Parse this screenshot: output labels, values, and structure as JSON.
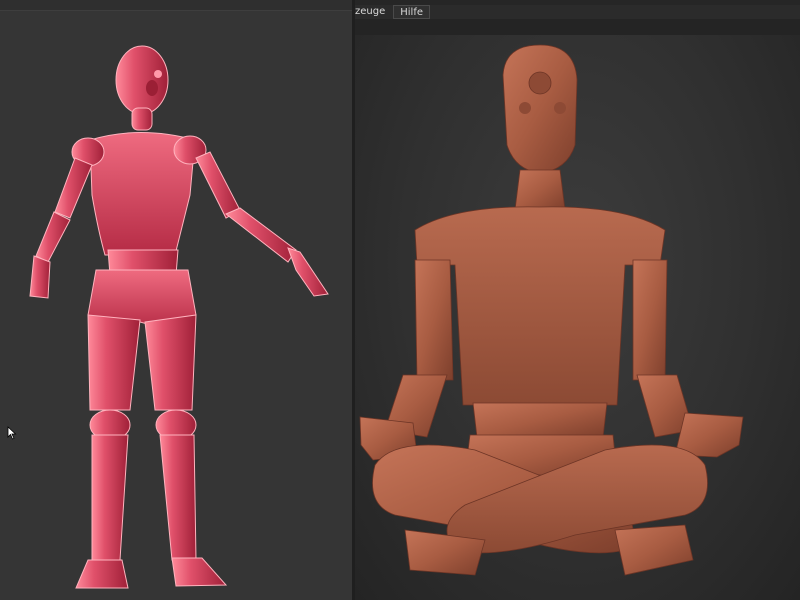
{
  "menubar": {
    "items": [
      {
        "label": "zeuge"
      },
      {
        "label": "Hilfe"
      }
    ]
  },
  "viewports": {
    "left": {
      "model": "red-standing-mannequin"
    },
    "right": {
      "model": "meditating-mannequin"
    }
  },
  "colors": {
    "left_model": "#d8485f",
    "right_model": "#a0583f",
    "background": "#333333"
  }
}
